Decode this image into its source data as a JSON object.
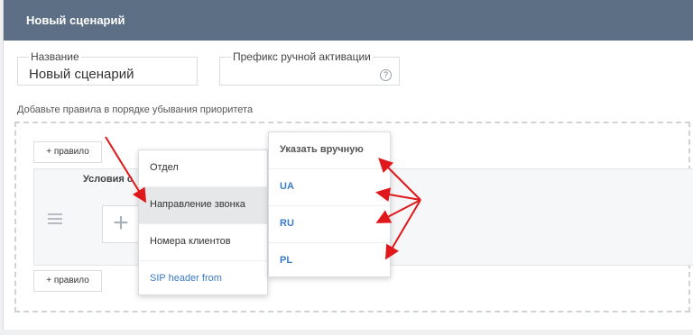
{
  "header": {
    "title": "Новый сценарий"
  },
  "fields": {
    "name": {
      "label": "Название",
      "value": "Новый сценарий"
    },
    "prefix": {
      "label": "Префикс ручной активации",
      "value": ""
    }
  },
  "hint": "Добавьте правила в порядке убывания приоритета",
  "rules": {
    "add_rule_label": "+ правило",
    "conditions_label": "Условия с",
    "plus_symbol": "+"
  },
  "condition_menu": {
    "items": [
      {
        "label": "Отдел",
        "active": false
      },
      {
        "label": "Направление звонка",
        "active": true
      },
      {
        "label": "Номера клиентов",
        "active": false
      },
      {
        "label": "SIP header from",
        "active": false
      }
    ]
  },
  "value_menu": {
    "items": [
      {
        "label": "Указать вручную"
      },
      {
        "label": "UA"
      },
      {
        "label": "RU"
      },
      {
        "label": "PL"
      }
    ]
  },
  "colors": {
    "header_bg": "#5d6f84",
    "link": "#3a7bc8",
    "annotation_arrow": "#e0181b"
  },
  "icons": {
    "help": "?"
  }
}
